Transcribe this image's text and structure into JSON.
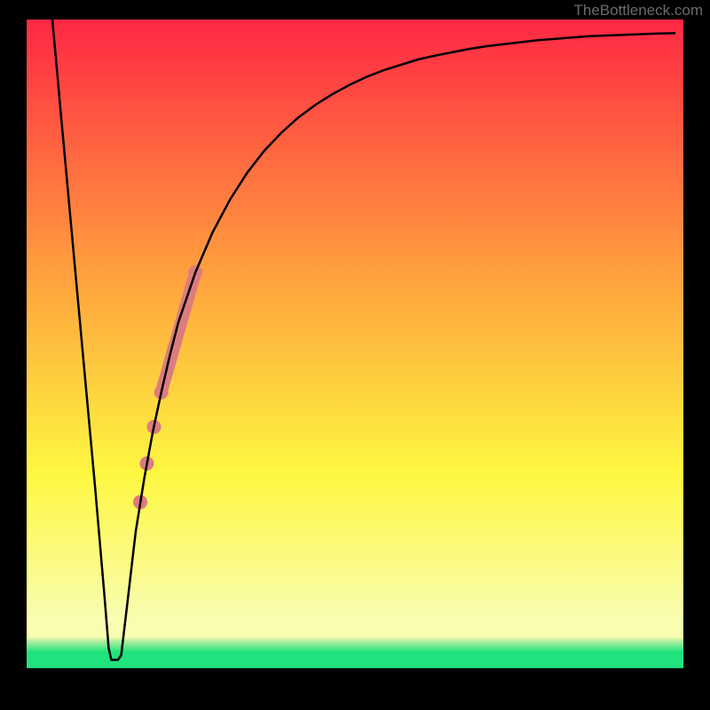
{
  "attribution": "TheBottleneck.com",
  "chart_data": {
    "type": "line",
    "title": "",
    "xlabel": "",
    "ylabel": "",
    "xlim": [
      0,
      1
    ],
    "ylim": [
      0,
      1
    ],
    "background_gradient": {
      "top": "#ff2744",
      "mid_top": "#ffa03e",
      "mid": "#fef740",
      "mid_bottom": "#f9fdb0",
      "bottom": "#21e37e",
      "green_band_start": 0.928,
      "green_band_end": 0.975
    },
    "frame_color": "#000000",
    "curve_color": "#000000",
    "curve_points": [
      {
        "x": 0.0392,
        "y": 0.0
      },
      {
        "x": 0.052,
        "y": 0.14
      },
      {
        "x": 0.065,
        "y": 0.28
      },
      {
        "x": 0.078,
        "y": 0.42
      },
      {
        "x": 0.091,
        "y": 0.56
      },
      {
        "x": 0.104,
        "y": 0.7
      },
      {
        "x": 0.111,
        "y": 0.78
      },
      {
        "x": 0.118,
        "y": 0.86
      },
      {
        "x": 0.125,
        "y": 0.945
      },
      {
        "x": 0.129,
        "y": 0.962
      },
      {
        "x": 0.134,
        "y": 0.962
      },
      {
        "x": 0.139,
        "y": 0.962
      },
      {
        "x": 0.144,
        "y": 0.955
      },
      {
        "x": 0.153,
        "y": 0.88
      },
      {
        "x": 0.166,
        "y": 0.77
      },
      {
        "x": 0.179,
        "y": 0.69
      },
      {
        "x": 0.192,
        "y": 0.62
      },
      {
        "x": 0.205,
        "y": 0.56
      },
      {
        "x": 0.218,
        "y": 0.505
      },
      {
        "x": 0.231,
        "y": 0.455
      },
      {
        "x": 0.257,
        "y": 0.38
      },
      {
        "x": 0.283,
        "y": 0.32
      },
      {
        "x": 0.31,
        "y": 0.27
      },
      {
        "x": 0.336,
        "y": 0.23
      },
      {
        "x": 0.362,
        "y": 0.197
      },
      {
        "x": 0.388,
        "y": 0.17
      },
      {
        "x": 0.414,
        "y": 0.147
      },
      {
        "x": 0.44,
        "y": 0.128
      },
      {
        "x": 0.466,
        "y": 0.112
      },
      {
        "x": 0.492,
        "y": 0.098
      },
      {
        "x": 0.518,
        "y": 0.086
      },
      {
        "x": 0.544,
        "y": 0.076
      },
      {
        "x": 0.57,
        "y": 0.068
      },
      {
        "x": 0.596,
        "y": 0.06
      },
      {
        "x": 0.623,
        "y": 0.054
      },
      {
        "x": 0.649,
        "y": 0.049
      },
      {
        "x": 0.675,
        "y": 0.044
      },
      {
        "x": 0.701,
        "y": 0.04
      },
      {
        "x": 0.727,
        "y": 0.037
      },
      {
        "x": 0.753,
        "y": 0.034
      },
      {
        "x": 0.779,
        "y": 0.031
      },
      {
        "x": 0.805,
        "y": 0.029
      },
      {
        "x": 0.831,
        "y": 0.027
      },
      {
        "x": 0.857,
        "y": 0.025
      },
      {
        "x": 0.883,
        "y": 0.024
      },
      {
        "x": 0.909,
        "y": 0.023
      },
      {
        "x": 0.936,
        "y": 0.022
      },
      {
        "x": 0.962,
        "y": 0.021
      },
      {
        "x": 0.988,
        "y": 0.0205
      }
    ],
    "highlight_segment": {
      "color": "#dd7c7e",
      "stroke_width": 14,
      "start": {
        "x": 0.205,
        "y": 0.56
      },
      "end": {
        "x": 0.257,
        "y": 0.38
      }
    },
    "dots": [
      {
        "x": 0.205,
        "y": 0.56,
        "r": 8,
        "color": "#dd7c7e"
      },
      {
        "x": 0.257,
        "y": 0.38,
        "r": 8,
        "color": "#dd7c7e"
      },
      {
        "x": 0.194,
        "y": 0.612,
        "r": 8,
        "color": "#dd7c7e"
      },
      {
        "x": 0.183,
        "y": 0.667,
        "r": 8,
        "color": "#dd7c7e"
      },
      {
        "x": 0.173,
        "y": 0.725,
        "r": 8,
        "color": "#dd7c7e"
      }
    ]
  }
}
